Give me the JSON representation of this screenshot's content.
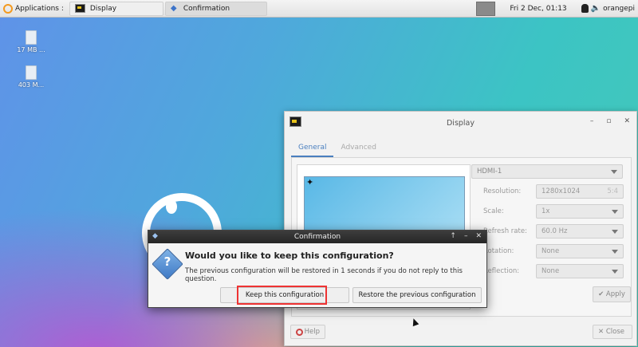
{
  "panel": {
    "apps_label": "Applications :",
    "tasks": [
      {
        "label": "Display"
      },
      {
        "label": "Confirmation"
      }
    ],
    "clock": "Fri  2 Dec, 01:13",
    "user": "orangepi"
  },
  "desktop": {
    "icons": [
      {
        "label": "17 MB ..."
      },
      {
        "label": "403 M..."
      }
    ]
  },
  "display_window": {
    "title": "Display",
    "controls": {
      "minimize": "–",
      "maximize": "▫",
      "close": "✕"
    },
    "tabs": [
      {
        "label": "General"
      },
      {
        "label": "Advanced"
      }
    ],
    "output": "HDMI-1",
    "settings": [
      {
        "label": "Resolution:",
        "value": "1280x1024",
        "extra": "5:4"
      },
      {
        "label": "Scale:",
        "value": "1x"
      },
      {
        "label": "Refresh rate:",
        "value": "60.0 Hz"
      },
      {
        "label": "Rotation:",
        "value": "None"
      },
      {
        "label": "Reflection:",
        "value": "None"
      }
    ],
    "apply_label": "✔ Apply",
    "help_label": "Help",
    "close_label": "✕ Close"
  },
  "dialog": {
    "title": "Confirmation",
    "controls": {
      "up": "↑",
      "minimize": "–",
      "close": "✕"
    },
    "heading": "Would you like to keep this configuration?",
    "message": "The previous configuration will be restored in 1 seconds if you do not reply to this question.",
    "keep_label": "Keep this configuration",
    "restore_label": "Restore the previous configuration"
  },
  "colors": {
    "accent": "#4a7fbf",
    "highlight": "#e33333",
    "dialog_title_bg": "#2e2e2e"
  }
}
